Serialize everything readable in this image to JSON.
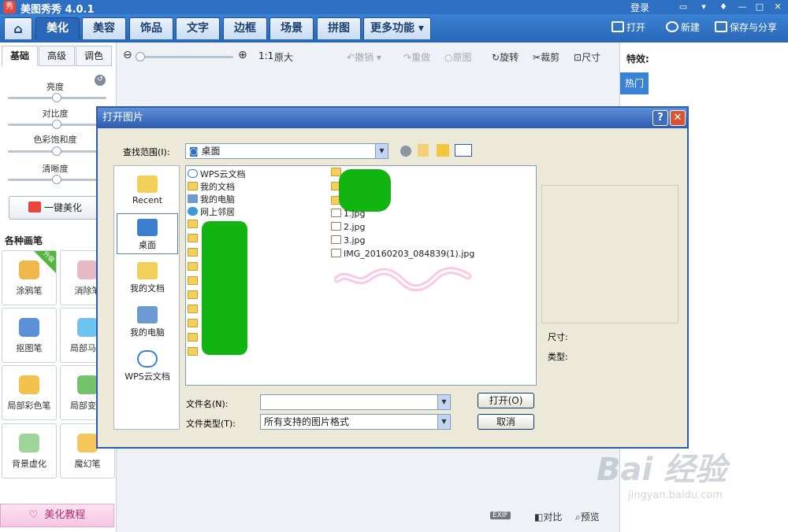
{
  "app": {
    "logo": "秀",
    "title": "美图秀秀 4.0.1",
    "login": "登录"
  },
  "tabs": [
    {
      "label": "⌂",
      "name": "home"
    },
    {
      "label": "美化",
      "name": "beautify"
    },
    {
      "label": "美容",
      "name": "beauty"
    },
    {
      "label": "饰品",
      "name": "accessories"
    },
    {
      "label": "文字",
      "name": "text"
    },
    {
      "label": "边框",
      "name": "border"
    },
    {
      "label": "场景",
      "name": "scene"
    },
    {
      "label": "拼图",
      "name": "collage"
    },
    {
      "label": "更多功能 ▾",
      "name": "more"
    }
  ],
  "right_tools": {
    "open": "打开",
    "new": "新建",
    "save": "保存与分享"
  },
  "left": {
    "subtabs": [
      "基础",
      "高级",
      "调色"
    ],
    "adjust": [
      "亮度",
      "对比度",
      "色彩饱和度",
      "清晰度"
    ],
    "one_key": "一键美化",
    "brushes_title": "各种画笔",
    "brushes": [
      "涂鸦笔",
      "消除笔",
      "抠图笔",
      "局部马赛",
      "局部彩色笔",
      "局部变色",
      "背景虚化",
      "魔幻笔"
    ],
    "badge": "升级",
    "tutorial": "美化教程"
  },
  "toolbar": {
    "zoom_ratio": "1:1",
    "original_size": "原大",
    "undo": "撤销",
    "redo": "重做",
    "original": "原图",
    "rotate": "旋转",
    "crop": "裁剪",
    "size": "尺寸"
  },
  "status": {
    "exif": "EXIF",
    "compare": "对比",
    "preview": "预览"
  },
  "right": {
    "effects_label": "特效:",
    "hot_tab": "热门"
  },
  "dialog": {
    "title": "打开图片",
    "help": "?",
    "close": "✕",
    "lookin_label": "查找范围(I):",
    "lookin_value": "桌面",
    "places": [
      "Recent",
      "桌面",
      "我的文档",
      "我的电脑",
      "WPS云文档"
    ],
    "files_left": [
      "WPS云文档",
      "我的文档",
      "我的电脑",
      "网上邻居"
    ],
    "files_right": [
      "1.jpg",
      "2.jpg",
      "3.jpg",
      "IMG_20160203_084839(1).jpg"
    ],
    "filename_label": "文件名(N):",
    "filename_value": "",
    "filetype_label": "文件类型(T):",
    "filetype_value": "所有支持的图片格式",
    "open_button": "打开(O)",
    "cancel_button": "取消",
    "size_label": "尺寸:",
    "type_label": "类型:"
  },
  "watermark": {
    "brand": "Bai 经验",
    "url": "jingyan.baidu.com"
  },
  "colors": {
    "accent": "#2d6fc0",
    "redact": "#12b412",
    "pink_scribble": "#f4a7d6"
  }
}
